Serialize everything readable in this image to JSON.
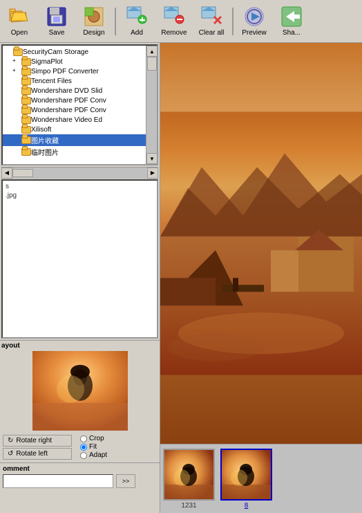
{
  "toolbar": {
    "buttons": [
      {
        "id": "open",
        "label": "Open",
        "icon": "📂"
      },
      {
        "id": "save",
        "label": "Save",
        "icon": "💾"
      },
      {
        "id": "design",
        "label": "Design",
        "icon": "🖼"
      },
      {
        "id": "add",
        "label": "Add",
        "icon": "🖼"
      },
      {
        "id": "remove",
        "label": "Remove",
        "icon": "❌"
      },
      {
        "id": "clear-all",
        "label": "Clear all",
        "icon": "🗑"
      },
      {
        "id": "preview",
        "label": "Preview",
        "icon": "▶"
      },
      {
        "id": "share",
        "label": "Sha...",
        "icon": "📤"
      }
    ]
  },
  "file_tree": {
    "items": [
      {
        "label": "SecurityCam Storage",
        "indent": 0,
        "expanded": false
      },
      {
        "label": "SigmaPlot",
        "indent": 1,
        "expanded": false
      },
      {
        "label": "Simpo PDF Converter",
        "indent": 1,
        "expanded": false
      },
      {
        "label": "Tencent Files",
        "indent": 1,
        "expanded": false
      },
      {
        "label": "Wondershare DVD Slid",
        "indent": 1,
        "expanded": false
      },
      {
        "label": "Wondershare PDF Conv",
        "indent": 1,
        "expanded": false
      },
      {
        "label": "Wondershare PDF Conv",
        "indent": 1,
        "expanded": false
      },
      {
        "label": "Wondershare Video Ed",
        "indent": 1,
        "expanded": false
      },
      {
        "label": "Xilisoft",
        "indent": 1,
        "expanded": false
      },
      {
        "label": "图片收藏",
        "indent": 1,
        "expanded": false
      },
      {
        "label": "临时图片",
        "indent": 1,
        "expanded": false
      }
    ]
  },
  "file_list": {
    "items": [
      {
        "name": "s"
      },
      {
        "name": ".jpg"
      }
    ]
  },
  "layout_section": {
    "label": "ayout"
  },
  "controls": {
    "rotate_right": "Rotate right",
    "rotate_left": "Rotate left",
    "crop": "Crop",
    "fit": "Fit",
    "adapt": "Adapt",
    "fit_selected": true
  },
  "comment_section": {
    "label": "omment",
    "go_label": ">>"
  },
  "thumbnails": [
    {
      "label": "1231",
      "selected": false
    },
    {
      "label": "8",
      "selected": true
    }
  ]
}
